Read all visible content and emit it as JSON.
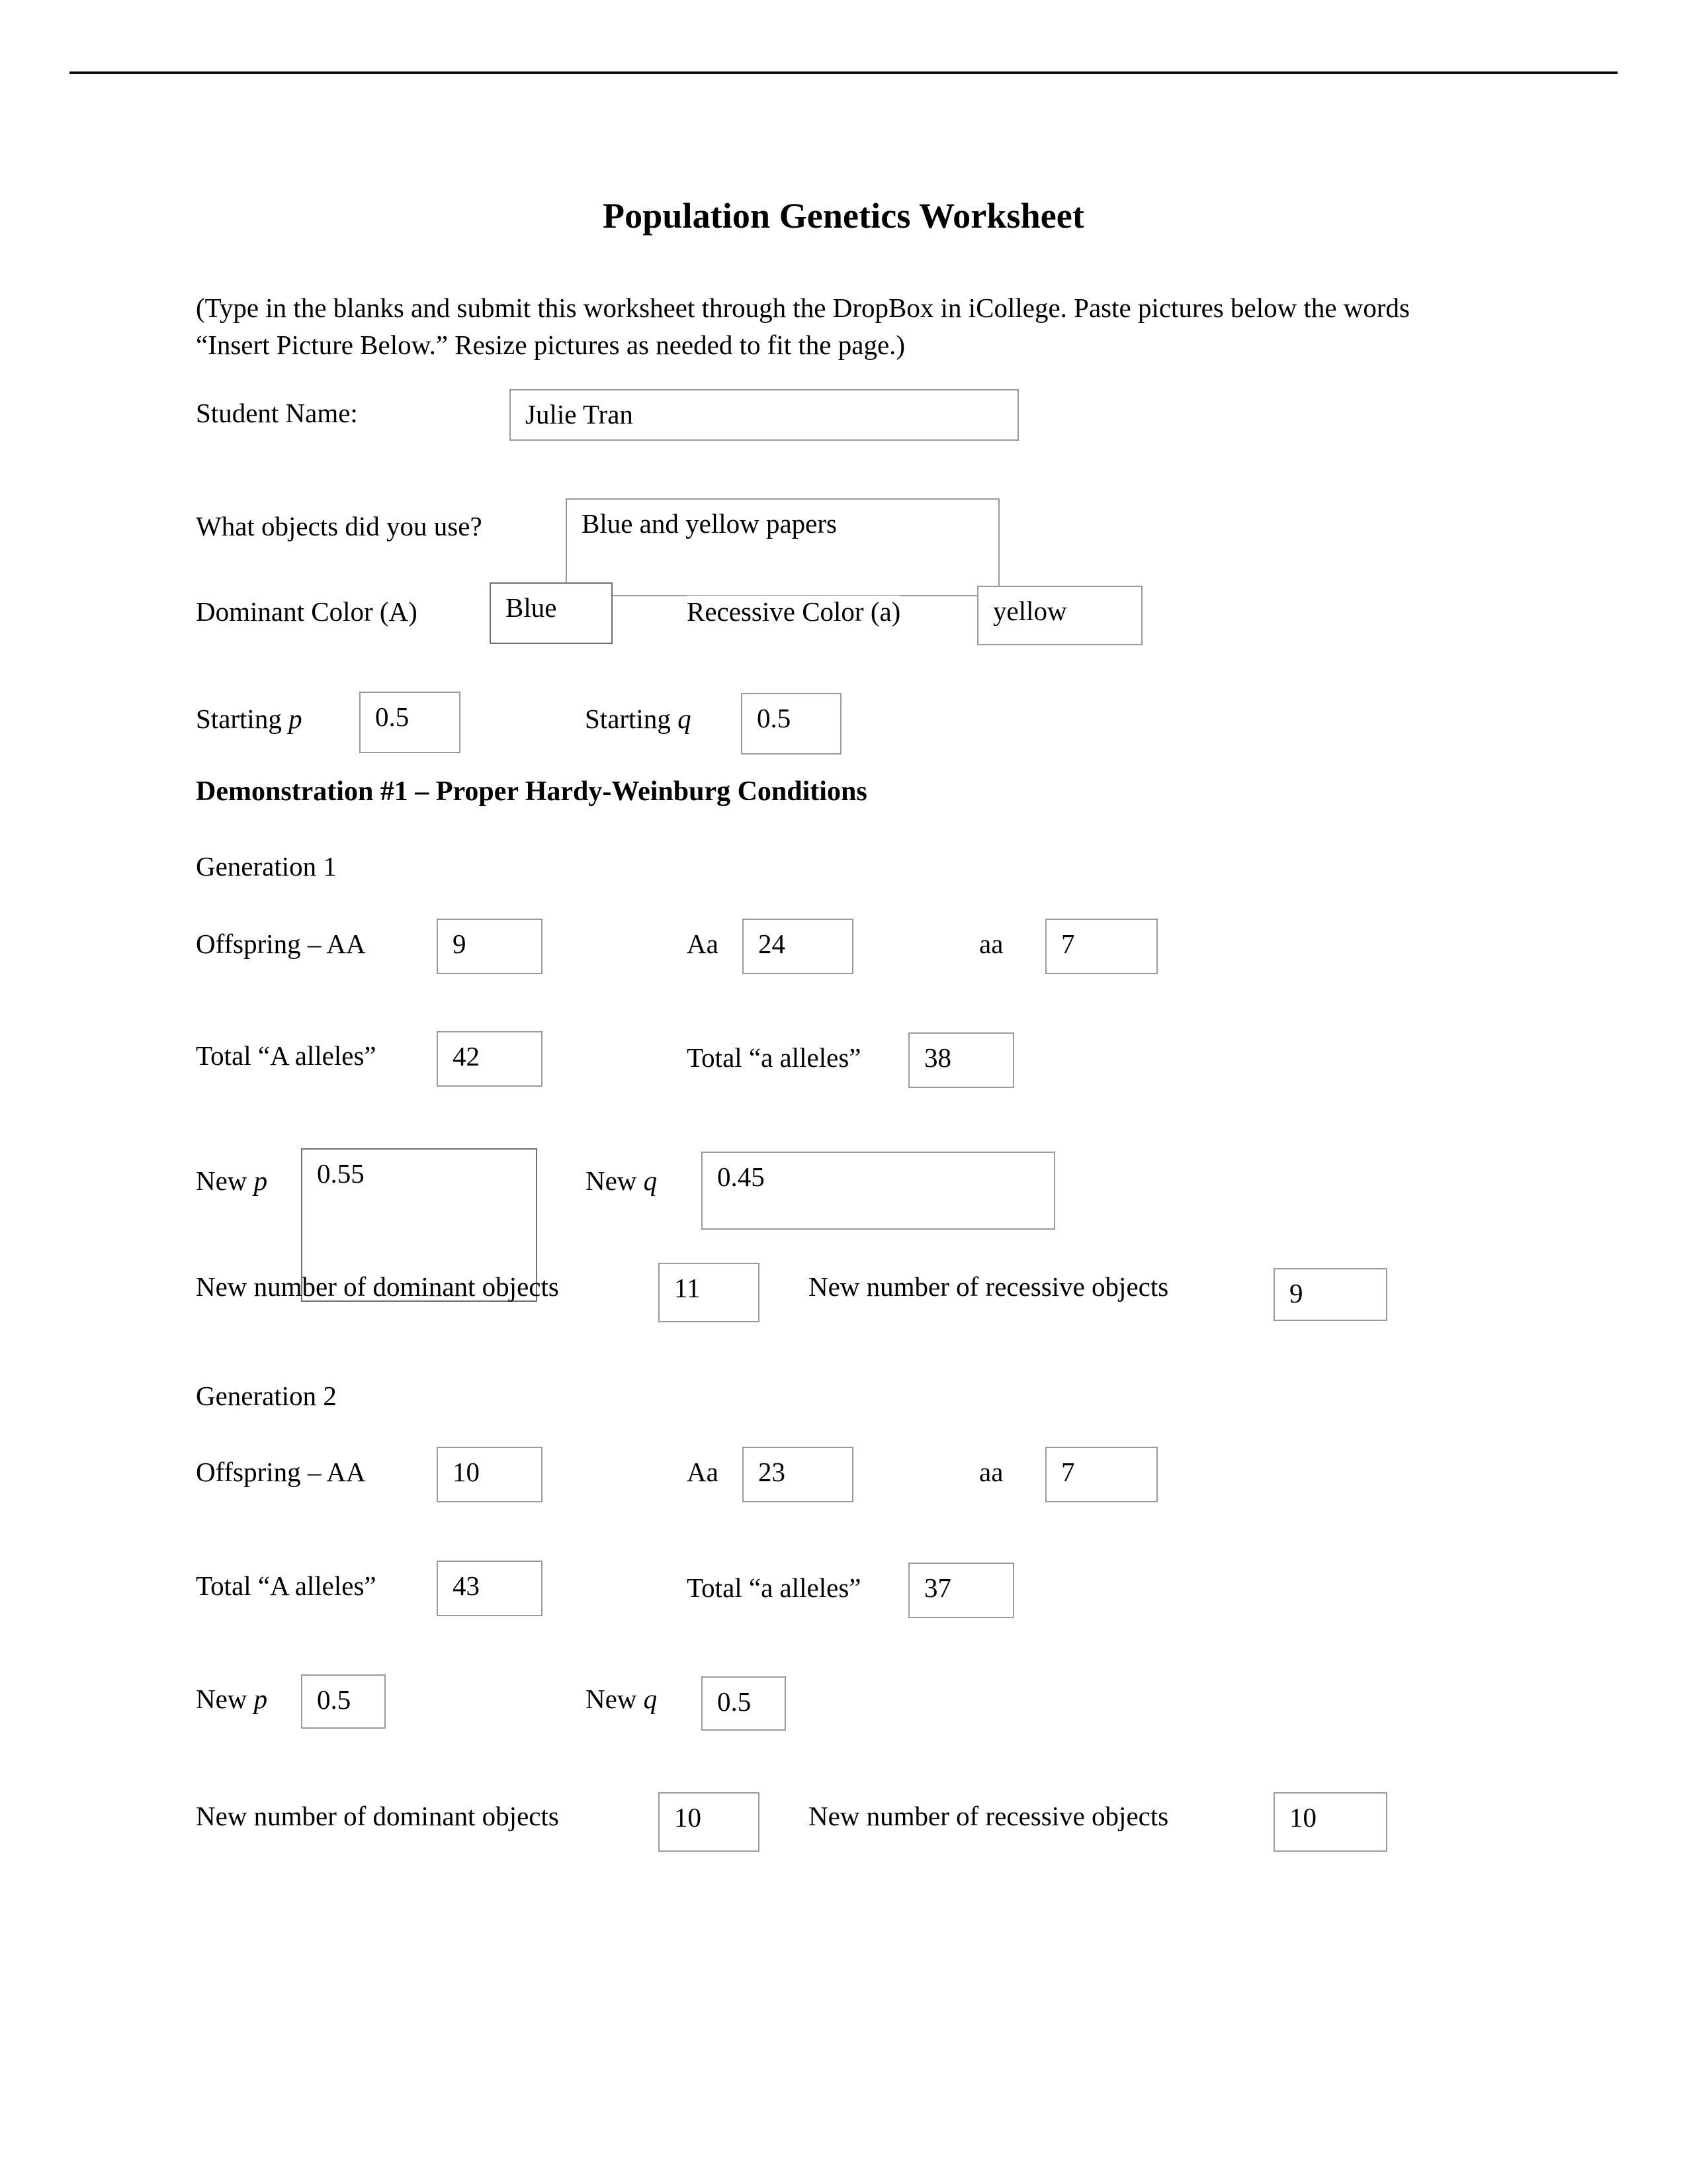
{
  "document": {
    "title": "Population Genetics Worksheet",
    "instructions": "(Type in the blanks and submit this worksheet through the DropBox in iCollege.  Paste pictures below the words “Insert Picture Below.”  Resize pictures as needed to fit the page.)"
  },
  "header": {
    "student_name_label": "Student Name:",
    "student_name_value": "Julie Tran"
  },
  "setup": {
    "objects_label": "What objects did you use?",
    "objects_value": "Blue and yellow papers",
    "dominant_label": "Dominant Color (A)",
    "dominant_value": "Blue",
    "recessive_label": "Recessive Color (a)",
    "recessive_value": "yellow",
    "starting_p_label": "Starting",
    "starting_p_symbol": "p",
    "starting_p_value": "0.5",
    "starting_q_label": "Starting",
    "starting_q_symbol": "q",
    "starting_q_value": "0.5"
  },
  "demo1": {
    "heading": "Demonstration #1 – Proper Hardy-Weinburg Conditions",
    "generations": [
      {
        "name": "Generation 1",
        "offspring_label": "Offspring – AA",
        "offspring_AA": "9",
        "het_label": "Aa",
        "offspring_Aa": "24",
        "rec_label": "aa",
        "offspring_aa": "7",
        "total_A_label": "Total “A alleles”",
        "total_A": "42",
        "total_a_label": "Total “a alleles”",
        "total_a": "38",
        "new_p_label": "New",
        "new_p_symbol": "p",
        "new_p": "0.55",
        "new_q_label": "New",
        "new_q_symbol": "q",
        "new_q": "0.45",
        "new_dominant_label": "New number of dominant objects",
        "new_dominant": "11",
        "new_recessive_label": "New number of recessive objects",
        "new_recessive": "9"
      },
      {
        "name": "Generation 2",
        "offspring_label": "Offspring – AA",
        "offspring_AA": "10",
        "het_label": "Aa",
        "offspring_Aa": "23",
        "rec_label": "aa",
        "offspring_aa": "7",
        "total_A_label": "Total “A alleles”",
        "total_A": "43",
        "total_a_label": "Total “a alleles”",
        "total_a": "37",
        "new_p_label": "New",
        "new_p_symbol": "p",
        "new_p": "0.5",
        "new_q_label": "New",
        "new_q_symbol": "q",
        "new_q": "0.5",
        "new_dominant_label": "New number of dominant objects",
        "new_dominant": "10",
        "new_recessive_label": "New number of recessive objects",
        "new_recessive": "10"
      }
    ]
  },
  "colors": {
    "text": "#000000",
    "rule": "#0b0b0b",
    "field_border": "#9a9a9a",
    "page_background": "#ffffff"
  }
}
